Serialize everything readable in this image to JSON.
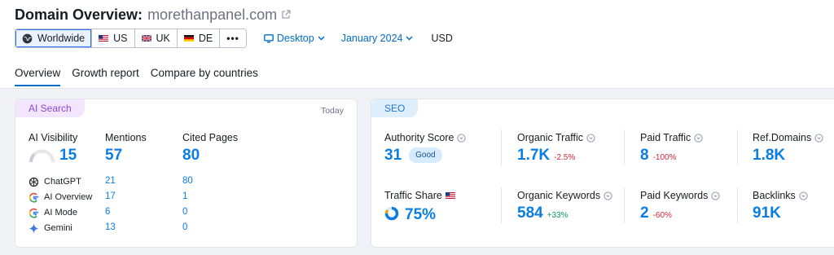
{
  "header": {
    "title": "Domain Overview:",
    "domain": "morethanpanel.com"
  },
  "databases": [
    {
      "label": "Worldwide",
      "icon": "globe-icon",
      "active": true
    },
    {
      "label": "US",
      "icon": "us-flag-icon"
    },
    {
      "label": "UK",
      "icon": "uk-flag-icon"
    },
    {
      "label": "DE",
      "icon": "de-flag-icon"
    }
  ],
  "controls": {
    "more": "•••",
    "device": "Desktop",
    "date": "January 2024",
    "currency": "USD"
  },
  "tabs": [
    "Overview",
    "Growth report",
    "Compare by countries"
  ],
  "ai_search": {
    "badge": "AI Search",
    "date_label": "Today",
    "visibility_label": "AI Visibility",
    "visibility_value": "15",
    "mentions_label": "Mentions",
    "mentions_value": "57",
    "cited_label": "Cited Pages",
    "cited_value": "80",
    "rows": [
      {
        "name": "ChatGPT",
        "mentions": "21",
        "cited": "80",
        "icon": "chatgpt-icon"
      },
      {
        "name": "AI Overview",
        "mentions": "17",
        "cited": "1",
        "icon": "google-icon"
      },
      {
        "name": "AI Mode",
        "mentions": "6",
        "cited": "0",
        "icon": "google-icon"
      },
      {
        "name": "Gemini",
        "mentions": "13",
        "cited": "0",
        "icon": "gemini-icon"
      }
    ]
  },
  "seo": {
    "badge": "SEO",
    "authority_label": "Authority Score",
    "authority_value": "31",
    "authority_rating": "Good",
    "organic_traffic_label": "Organic Traffic",
    "organic_traffic_value": "1.7K",
    "organic_traffic_delta": "-2.5%",
    "paid_traffic_label": "Paid Traffic",
    "paid_traffic_value": "8",
    "paid_traffic_delta": "-100%",
    "ref_domains_label": "Ref.Domains",
    "ref_domains_value": "1.8K",
    "traffic_share_label": "Traffic Share",
    "traffic_share_value": "75%",
    "organic_keywords_label": "Organic Keywords",
    "organic_keywords_value": "584",
    "organic_keywords_delta": "+33%",
    "paid_keywords_label": "Paid Keywords",
    "paid_keywords_value": "2",
    "paid_keywords_delta": "-60%",
    "backlinks_label": "Backlinks",
    "backlinks_value": "91K"
  },
  "colors": {
    "accent": "#006dca",
    "value_blue": "#0a7de5",
    "negative": "#d7263d",
    "positive": "#119967",
    "ai_badge": "#8f47d6",
    "seo_badge": "#1f7ad8"
  }
}
